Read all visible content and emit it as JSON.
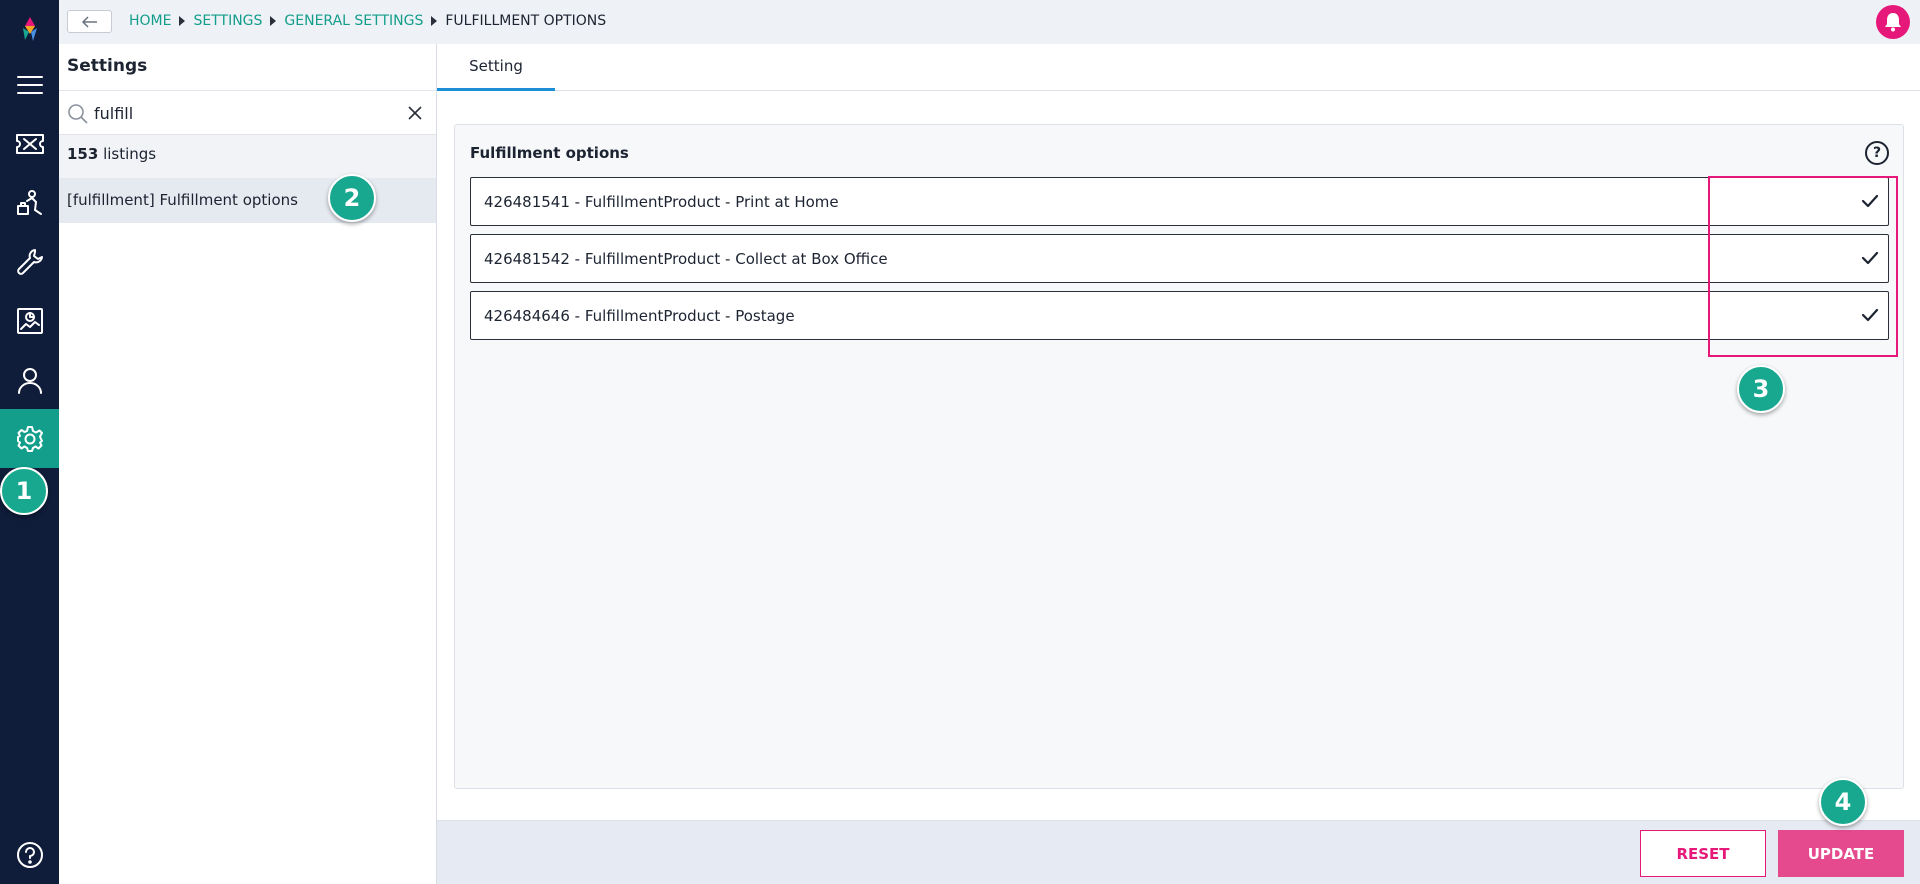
{
  "nav": {
    "items": [
      {
        "name": "menu-icon"
      },
      {
        "name": "ticket-icon"
      },
      {
        "name": "customers-icon"
      },
      {
        "name": "tools-icon"
      },
      {
        "name": "reports-icon"
      },
      {
        "name": "user-icon"
      },
      {
        "name": "settings-icon",
        "active": true
      }
    ],
    "help_icon": "help-icon"
  },
  "breadcrumb": {
    "items": [
      "HOME",
      "SETTINGS",
      "GENERAL SETTINGS"
    ],
    "current": "FULFILLMENT OPTIONS"
  },
  "sidebar": {
    "title": "Settings",
    "search": {
      "value": "fulfill",
      "placeholder": ""
    },
    "count": "153",
    "count_label": " listings",
    "results": [
      "[fulfillment] Fulfillment options"
    ]
  },
  "main": {
    "tabs": [
      "Setting"
    ],
    "card": {
      "title": "Fulfillment options",
      "help": "?",
      "options": [
        {
          "label": "426481541 - FulfillmentProduct - Print at Home",
          "checked": true
        },
        {
          "label": "426481542 - FulfillmentProduct - Collect at Box Office",
          "checked": true
        },
        {
          "label": "426484646 - FulfillmentProduct - Postage",
          "checked": true
        }
      ]
    }
  },
  "footer": {
    "reset_label": "RESET",
    "update_label": "UPDATE"
  },
  "annotations": [
    "1",
    "2",
    "3",
    "4"
  ],
  "colors": {
    "rail": "#0f1c3a",
    "accent": "#139e8b",
    "brand_pink": "#e6197a",
    "update_button": "#e54a8e",
    "tab_underline": "#1c8ed6",
    "badge": "#17a88f"
  }
}
